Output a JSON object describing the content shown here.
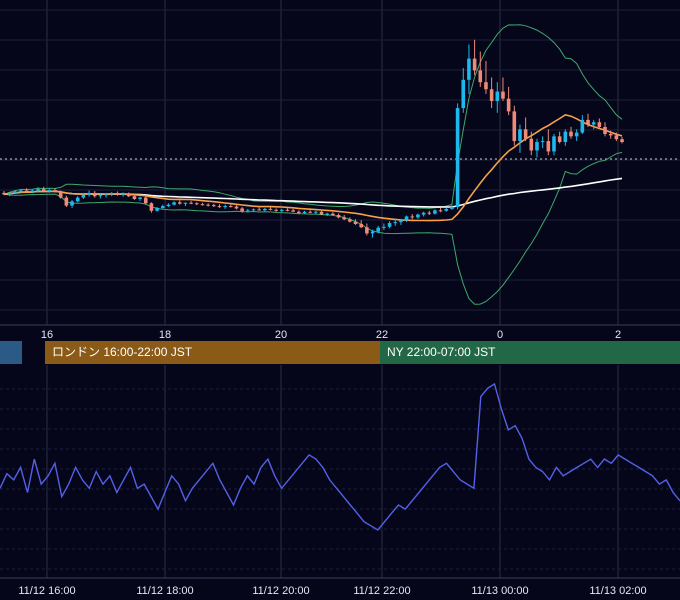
{
  "colors": {
    "background": "#05061a",
    "grid_v": "#2a2f45",
    "grid_h": "#1c2038",
    "candle_up": "#1fb8ec",
    "candle_down": "#f08a78",
    "ma_short": "#f5a14a",
    "ma_long": "#ffffff",
    "bollinger": "#3daa6a",
    "oscillator": "#5560e6",
    "price_line": "#c8c8d8"
  },
  "main_axis": {
    "ticks": [
      "16",
      "18",
      "20",
      "22",
      "0",
      "2"
    ]
  },
  "sessions": {
    "london_label": "ロンドン 16:00-22:00 JST",
    "ny_label": "NY 22:00-07:00 JST",
    "tokyo_color": "#2b5a86",
    "london_color": "#8b5a16",
    "ny_color": "#226847"
  },
  "bottom_axis": {
    "ticks": [
      "11/12 16:00",
      "11/12 18:00",
      "11/12 20:00",
      "11/12 22:00",
      "11/13 00:00",
      "11/13 02:00"
    ]
  },
  "chart_data": [
    {
      "type": "candlestick",
      "title": "",
      "x": [
        "15:00",
        "15:06",
        "15:12",
        "15:18",
        "15:24",
        "15:30",
        "15:36",
        "15:42",
        "15:48",
        "15:54",
        "16:00",
        "16:06",
        "16:12",
        "16:18",
        "16:24",
        "16:30",
        "16:36",
        "16:42",
        "16:48",
        "16:54",
        "17:00",
        "17:06",
        "17:12",
        "17:18",
        "17:24",
        "17:30",
        "17:36",
        "17:42",
        "17:48",
        "17:54",
        "18:00",
        "18:06",
        "18:12",
        "18:18",
        "18:24",
        "18:30",
        "18:36",
        "18:42",
        "18:48",
        "18:54",
        "19:00",
        "19:06",
        "19:12",
        "19:18",
        "19:24",
        "19:30",
        "19:36",
        "19:42",
        "19:48",
        "19:54",
        "20:00",
        "20:06",
        "20:12",
        "20:18",
        "20:24",
        "20:30",
        "20:36",
        "20:42",
        "20:48",
        "20:54",
        "21:00",
        "21:06",
        "21:12",
        "21:18",
        "21:24",
        "21:30",
        "21:36",
        "21:42",
        "21:48",
        "21:54",
        "22:00",
        "22:06",
        "22:12",
        "22:18",
        "22:24",
        "22:30",
        "22:36",
        "22:42",
        "22:48",
        "22:54",
        "23:00",
        "23:06",
        "23:12",
        "23:18",
        "23:24",
        "23:30",
        "23:36",
        "23:42",
        "23:48",
        "23:54",
        "00:00",
        "00:06",
        "00:12",
        "00:18",
        "00:24",
        "00:30",
        "00:36",
        "00:42",
        "00:48",
        "00:54",
        "01:00",
        "01:06",
        "01:12",
        "01:18",
        "01:24",
        "01:30",
        "01:36",
        "01:42",
        "01:48",
        "01:54",
        "02:00",
        "02:06",
        "02:12",
        "02:18",
        "02:24",
        "02:30",
        "02:36",
        "02:42",
        "02:48",
        "02:54"
      ],
      "ohlc": [
        [
          5.0,
          5.4,
          4.5,
          4.7
        ],
        [
          4.7,
          5.2,
          4.3,
          5.0
        ],
        [
          5.0,
          5.6,
          4.8,
          5.3
        ],
        [
          5.3,
          5.8,
          5.0,
          5.5
        ],
        [
          5.5,
          6.0,
          5.1,
          5.3
        ],
        [
          5.3,
          5.7,
          4.9,
          5.5
        ],
        [
          5.5,
          6.2,
          5.2,
          5.8
        ],
        [
          5.8,
          6.3,
          5.3,
          5.4
        ],
        [
          5.4,
          5.9,
          5.0,
          5.6
        ],
        [
          5.6,
          6.0,
          5.1,
          5.2
        ],
        [
          5.2,
          5.5,
          3.8,
          4.0
        ],
        [
          4.0,
          4.4,
          2.0,
          2.3
        ],
        [
          2.3,
          3.5,
          1.8,
          3.2
        ],
        [
          3.2,
          4.3,
          3.0,
          4.0
        ],
        [
          4.0,
          5.0,
          3.7,
          4.6
        ],
        [
          4.6,
          5.5,
          4.2,
          5.0
        ],
        [
          5.0,
          5.4,
          4.0,
          4.3
        ],
        [
          4.3,
          4.8,
          3.8,
          4.5
        ],
        [
          4.5,
          5.0,
          4.0,
          4.7
        ],
        [
          4.7,
          5.2,
          4.3,
          4.9
        ],
        [
          4.9,
          5.3,
          4.4,
          4.6
        ],
        [
          4.6,
          5.1,
          4.2,
          4.8
        ],
        [
          4.8,
          5.1,
          4.1,
          4.3
        ],
        [
          4.3,
          4.6,
          3.5,
          3.7
        ],
        [
          3.7,
          4.2,
          3.3,
          4.0
        ],
        [
          4.0,
          4.3,
          2.5,
          2.8
        ],
        [
          2.8,
          3.0,
          0.8,
          1.2
        ],
        [
          1.2,
          2.0,
          1.0,
          1.8
        ],
        [
          1.8,
          2.5,
          1.5,
          2.2
        ],
        [
          2.2,
          2.8,
          2.0,
          2.5
        ],
        [
          2.5,
          3.2,
          2.3,
          3.0
        ],
        [
          3.0,
          3.4,
          2.5,
          2.7
        ],
        [
          2.7,
          3.0,
          2.2,
          2.9
        ],
        [
          2.9,
          3.3,
          2.6,
          2.8
        ],
        [
          2.8,
          3.0,
          2.4,
          2.6
        ],
        [
          2.6,
          2.9,
          2.3,
          2.5
        ],
        [
          2.5,
          2.8,
          2.1,
          2.4
        ],
        [
          2.4,
          2.7,
          2.0,
          2.2
        ],
        [
          2.2,
          2.6,
          1.8,
          2.0
        ],
        [
          2.0,
          2.5,
          1.6,
          2.2
        ],
        [
          2.2,
          2.6,
          1.9,
          2.1
        ],
        [
          2.1,
          2.4,
          1.5,
          1.7
        ],
        [
          1.7,
          2.0,
          0.8,
          1.1
        ],
        [
          1.1,
          1.6,
          0.9,
          1.3
        ],
        [
          1.3,
          1.7,
          1.0,
          1.5
        ],
        [
          1.5,
          1.9,
          1.2,
          1.3
        ],
        [
          1.3,
          1.8,
          1.1,
          1.6
        ],
        [
          1.6,
          2.0,
          1.3,
          1.4
        ],
        [
          1.4,
          1.7,
          1.0,
          1.2
        ],
        [
          1.2,
          1.6,
          0.9,
          1.4
        ],
        [
          1.4,
          1.7,
          1.1,
          1.3
        ],
        [
          1.3,
          1.6,
          0.9,
          1.0
        ],
        [
          1.0,
          1.3,
          0.5,
          0.7
        ],
        [
          0.7,
          1.2,
          0.5,
          1.0
        ],
        [
          1.0,
          1.3,
          0.7,
          0.8
        ],
        [
          0.8,
          1.2,
          0.5,
          1.0
        ],
        [
          1.0,
          1.2,
          0.3,
          0.4
        ],
        [
          0.4,
          0.8,
          0.1,
          0.6
        ],
        [
          0.6,
          0.9,
          0.2,
          0.3
        ],
        [
          0.3,
          0.6,
          -0.4,
          -0.2
        ],
        [
          -0.2,
          0.3,
          -0.8,
          -0.6
        ],
        [
          -0.6,
          -0.2,
          -1.3,
          -1.1
        ],
        [
          -1.1,
          -0.6,
          -1.8,
          -1.6
        ],
        [
          -1.6,
          -0.8,
          -2.5,
          -2.3
        ],
        [
          -2.3,
          -1.5,
          -4.0,
          -3.6
        ],
        [
          -3.6,
          -2.8,
          -4.5,
          -3.2
        ],
        [
          -3.2,
          -2.0,
          -3.6,
          -2.4
        ],
        [
          -2.4,
          -1.5,
          -2.9,
          -2.2
        ],
        [
          -2.2,
          -1.0,
          -2.5,
          -1.4
        ],
        [
          -1.4,
          -0.6,
          -2.0,
          -1.2
        ],
        [
          -1.2,
          -0.5,
          -1.8,
          -0.8
        ],
        [
          -0.8,
          0.2,
          -1.2,
          0.0
        ],
        [
          0.0,
          0.5,
          -0.6,
          -0.2
        ],
        [
          -0.2,
          0.6,
          -0.5,
          0.4
        ],
        [
          0.4,
          1.0,
          0.0,
          0.8
        ],
        [
          0.8,
          1.2,
          0.3,
          0.6
        ],
        [
          0.6,
          1.5,
          0.4,
          1.3
        ],
        [
          1.3,
          1.8,
          0.9,
          1.2
        ],
        [
          1.2,
          1.9,
          1.0,
          1.6
        ],
        [
          1.6,
          2.4,
          1.4,
          2.0
        ],
        [
          2.0,
          24.0,
          1.5,
          23.0
        ],
        [
          23.0,
          31.5,
          22.0,
          29.0
        ],
        [
          29.0,
          36.5,
          26.0,
          33.5
        ],
        [
          33.5,
          37.5,
          30.0,
          31.0
        ],
        [
          31.0,
          35.0,
          27.5,
          28.5
        ],
        [
          28.5,
          33.0,
          26.0,
          27.0
        ],
        [
          27.0,
          29.5,
          23.0,
          24.5
        ],
        [
          24.5,
          28.5,
          22.0,
          26.5
        ],
        [
          26.5,
          29.5,
          24.5,
          25.0
        ],
        [
          25.0,
          27.5,
          21.5,
          22.3
        ],
        [
          22.3,
          23.5,
          15.0,
          16.0
        ],
        [
          16.0,
          19.5,
          13.5,
          18.5
        ],
        [
          18.5,
          21.0,
          16.0,
          16.5
        ],
        [
          16.5,
          18.0,
          13.0,
          14.0
        ],
        [
          14.0,
          16.5,
          12.5,
          15.8
        ],
        [
          15.8,
          17.0,
          14.5,
          16.0
        ],
        [
          16.0,
          18.5,
          13.0,
          13.8
        ],
        [
          13.8,
          17.5,
          13.0,
          17.0
        ],
        [
          17.0,
          18.0,
          15.5,
          15.8
        ],
        [
          15.8,
          18.5,
          15.0,
          18.0
        ],
        [
          18.0,
          19.0,
          16.5,
          17.0
        ],
        [
          17.0,
          18.5,
          16.0,
          17.8
        ],
        [
          17.8,
          21.5,
          17.5,
          20.5
        ],
        [
          20.5,
          21.8,
          19.0,
          19.5
        ],
        [
          19.5,
          20.5,
          18.5,
          20.0
        ],
        [
          20.0,
          20.8,
          18.6,
          19.0
        ],
        [
          19.0,
          20.0,
          17.0,
          17.5
        ],
        [
          17.5,
          18.2,
          16.5,
          17.2
        ],
        [
          17.2,
          17.8,
          16.0,
          16.4
        ],
        [
          16.4,
          16.9,
          15.5,
          15.8
        ]
      ]
    },
    {
      "type": "line",
      "title": "",
      "x": [
        "16:00",
        "18:00",
        "20:00",
        "22:00",
        "00:00",
        "02:00"
      ],
      "oscillator": [
        48,
        55,
        52,
        58,
        46,
        62,
        50,
        54,
        60,
        44,
        50,
        58,
        52,
        48,
        56,
        50,
        54,
        46,
        52,
        58,
        48,
        50,
        44,
        38,
        46,
        54,
        50,
        42,
        48,
        52,
        56,
        60,
        52,
        46,
        40,
        48,
        54,
        50,
        58,
        62,
        54,
        48,
        52,
        56,
        60,
        64,
        62,
        58,
        52,
        48,
        44,
        40,
        36,
        32,
        30,
        28,
        32,
        36,
        40,
        38,
        42,
        46,
        50,
        54,
        58,
        60,
        56,
        52,
        50,
        48,
        92,
        96,
        98,
        86,
        76,
        78,
        72,
        62,
        58,
        56,
        52,
        58,
        54,
        56,
        58,
        60,
        62,
        58,
        62,
        60,
        64,
        62,
        60,
        58,
        56,
        54,
        50,
        52,
        46,
        42
      ]
    }
  ]
}
